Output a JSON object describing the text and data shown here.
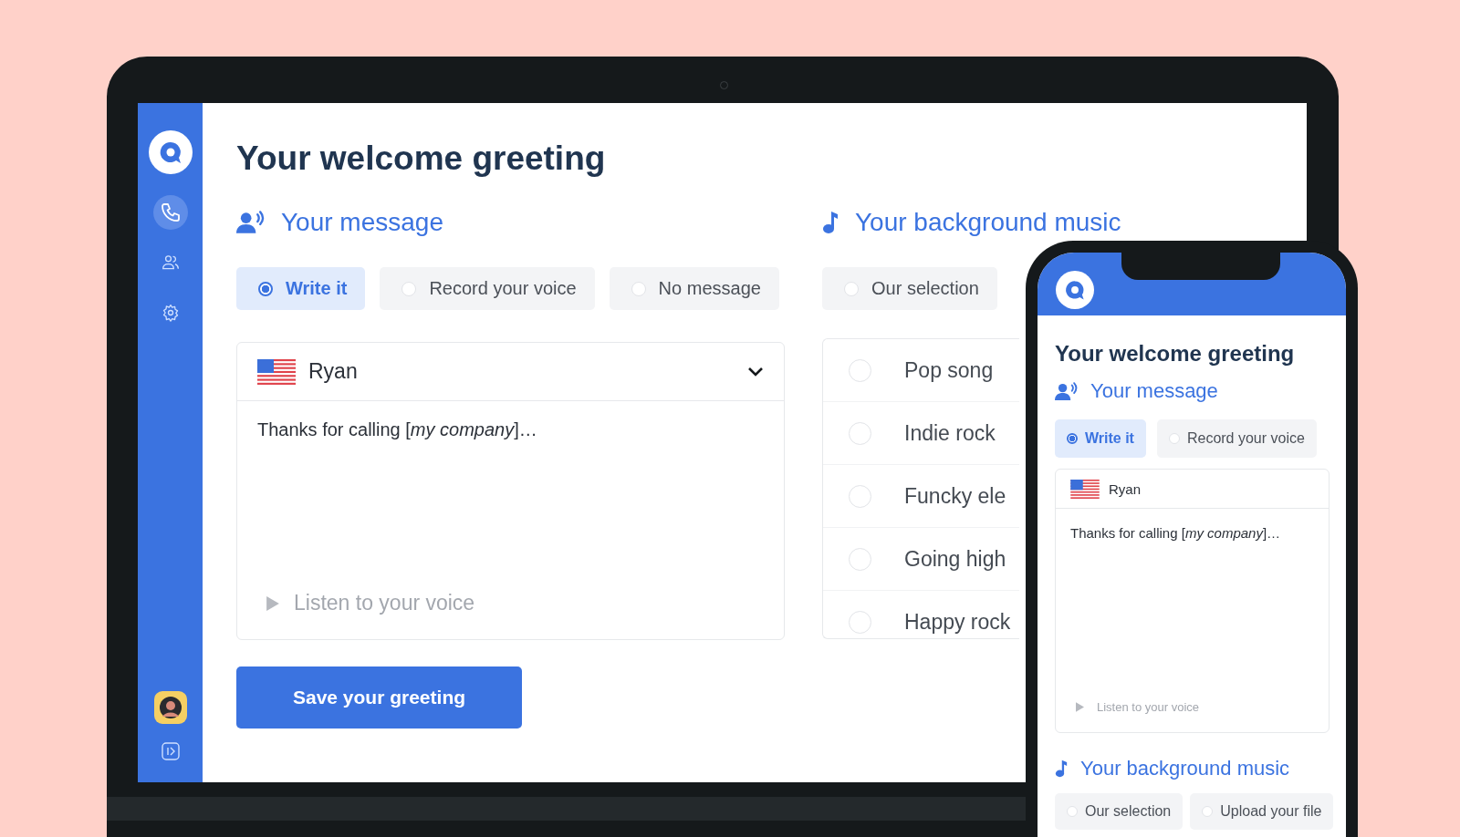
{
  "sidebar": {
    "items": [
      {
        "kind": "phone",
        "selected": true
      },
      {
        "kind": "contacts",
        "selected": false
      },
      {
        "kind": "settings",
        "selected": false
      }
    ]
  },
  "laptop": {
    "title": "Your welcome greeting",
    "message": {
      "heading": "Your message",
      "options": [
        {
          "label": "Write it",
          "selected": true
        },
        {
          "label": "Record your voice",
          "selected": false
        },
        {
          "label": "No message",
          "selected": false
        }
      ],
      "voice": {
        "name": "Ryan",
        "text": "Thanks for calling [*my company*]…",
        "listen": "Listen to your voice"
      }
    },
    "music": {
      "heading": "Your background music",
      "options": [
        {
          "label": "Our selection",
          "selected": false
        }
      ],
      "tracks": [
        {
          "label": "Pop song",
          "selected": false
        },
        {
          "label": "Indie rock",
          "selected": false
        },
        {
          "label": "Funcky ele",
          "selected": false
        },
        {
          "label": "Going high",
          "selected": false
        },
        {
          "label": "Happy rock",
          "selected": false
        }
      ]
    },
    "save_button": "Save your greeting"
  },
  "phone": {
    "title": "Your welcome greeting",
    "message": {
      "heading": "Your message",
      "options": [
        {
          "label": "Write it",
          "selected": true
        },
        {
          "label": "Record your voice",
          "selected": false
        }
      ],
      "voice": {
        "name": "Ryan",
        "text": "Thanks for calling [*my company*]…",
        "listen": "Listen to your voice"
      }
    },
    "music": {
      "heading": "Your background music",
      "options": [
        {
          "label": "Our selection",
          "selected": false
        },
        {
          "label": "Upload your file",
          "selected": false
        }
      ]
    }
  }
}
